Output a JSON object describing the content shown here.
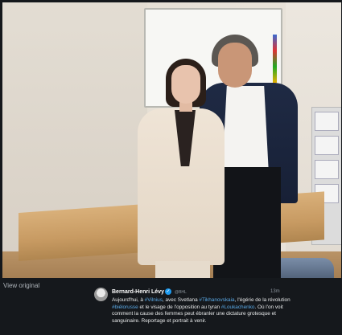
{
  "view_original": "View original",
  "tweet": {
    "author": "Bernard-Henri Lévy",
    "handle": "@BHL",
    "time": "13m",
    "text": {
      "t1": "Aujourd'hui, à ",
      "tag1": "#Vilnius",
      "t2": ", avec Svetlana ",
      "tag2": "#Tikhanovskaia",
      "t3": ", l'égérie de la révolution ",
      "tag3": "#biélorusse",
      "t4": " et le visage de l'opposition au tyran ",
      "tag4": "#Loukachenko",
      "t5": ". Où l'on voit comment la cause des femmes peut ébranler une dictature grotesque et sanguinaire. Reportage et portrait à venir."
    }
  },
  "colors": {
    "hashtag": "#5aa9e6",
    "verified": "#1d9bf0",
    "background": "#15181c"
  },
  "icons": {
    "verified": "verified-badge-icon",
    "avatar": "avatar"
  }
}
